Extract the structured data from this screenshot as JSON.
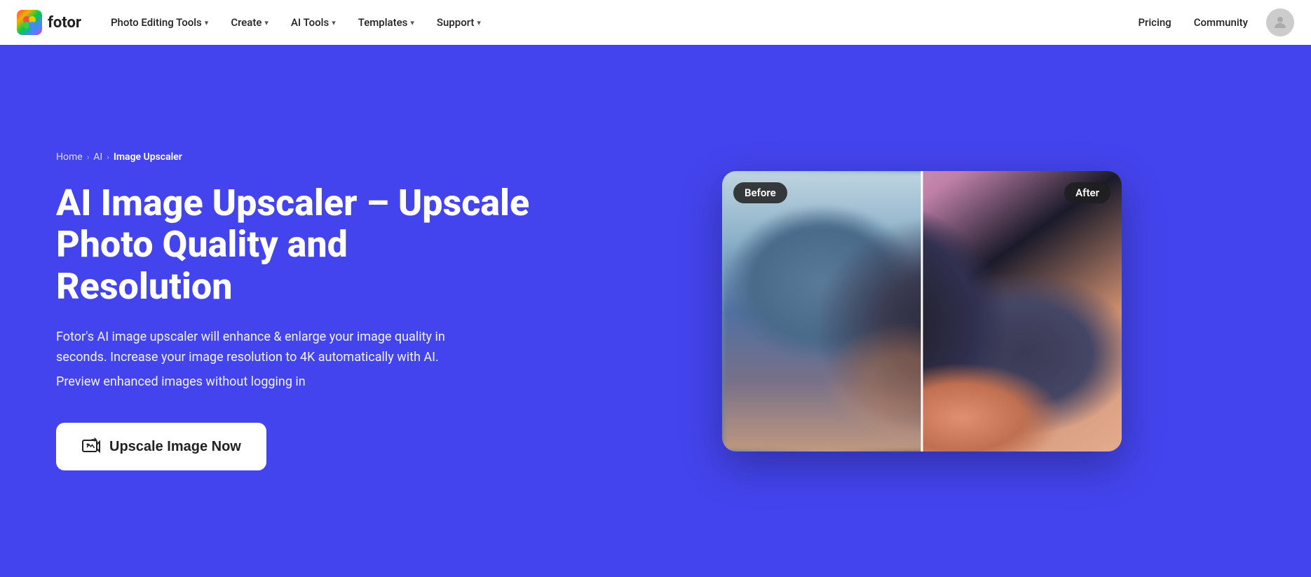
{
  "brand": {
    "name": "fotor",
    "logo_emoji": "🎨"
  },
  "nav": {
    "items": [
      {
        "label": "Photo Editing Tools",
        "has_dropdown": true
      },
      {
        "label": "Create",
        "has_dropdown": true
      },
      {
        "label": "AI Tools",
        "has_dropdown": true
      },
      {
        "label": "Templates",
        "has_dropdown": true
      },
      {
        "label": "Support",
        "has_dropdown": true
      }
    ],
    "right_links": [
      {
        "label": "Pricing"
      },
      {
        "label": "Community"
      }
    ]
  },
  "breadcrumb": {
    "home": "Home",
    "ai": "AI",
    "current": "Image Upscaler"
  },
  "hero": {
    "title": "AI Image Upscaler – Upscale Photo Quality and Resolution",
    "description": "Fotor's AI image upscaler will enhance & enlarge your image quality in seconds. Increase your image resolution to 4K automatically with AI.",
    "sub_description": "Preview enhanced images without logging in",
    "cta_label": "Upscale Image Now"
  },
  "image_compare": {
    "before_label": "Before",
    "after_label": "After"
  },
  "colors": {
    "hero_bg": "#4444ee",
    "nav_bg": "#ffffff",
    "cta_bg": "#ffffff",
    "cta_text": "#222222"
  }
}
